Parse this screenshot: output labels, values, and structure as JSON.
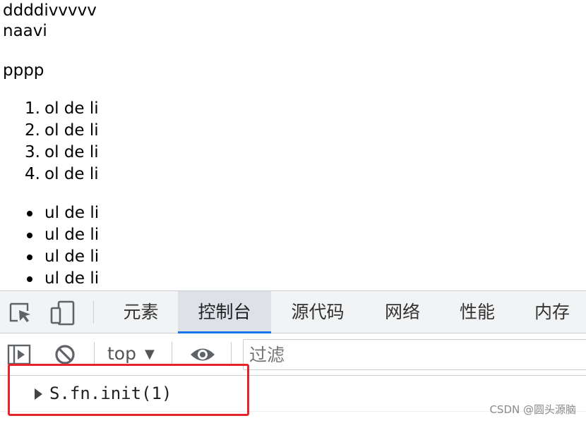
{
  "page": {
    "div_text": "ddddivvvvv",
    "nav_text": "naavi",
    "p_text": "pppp",
    "ol_items": [
      {
        "num": "1.",
        "text": "ol de li"
      },
      {
        "num": "2.",
        "text": "ol de li"
      },
      {
        "num": "3.",
        "text": "ol de li"
      },
      {
        "num": "4.",
        "text": "ol de li"
      }
    ],
    "ul_items": [
      "ul de li",
      "ul de li",
      "ul de li",
      "ul de li"
    ]
  },
  "devtools": {
    "tabs": [
      "元素",
      "控制台",
      "源代码",
      "网络",
      "性能",
      "内存"
    ],
    "active_tab": "控制台",
    "toolbar": {
      "context": "top",
      "filter_placeholder": "过滤"
    },
    "console": {
      "entry": "S.fn.init(1)"
    },
    "icons": [
      "inspect-element-icon",
      "device-toolbar-icon",
      "sidebar-toggle-icon",
      "clear-console-icon",
      "dropdown-arrow-icon",
      "live-expression-eye-icon",
      "expand-triangle-icon"
    ],
    "colors": {
      "accent": "#1a73e8",
      "highlight": "#e8242a"
    }
  },
  "watermark": "CSDN @圆头源脑"
}
